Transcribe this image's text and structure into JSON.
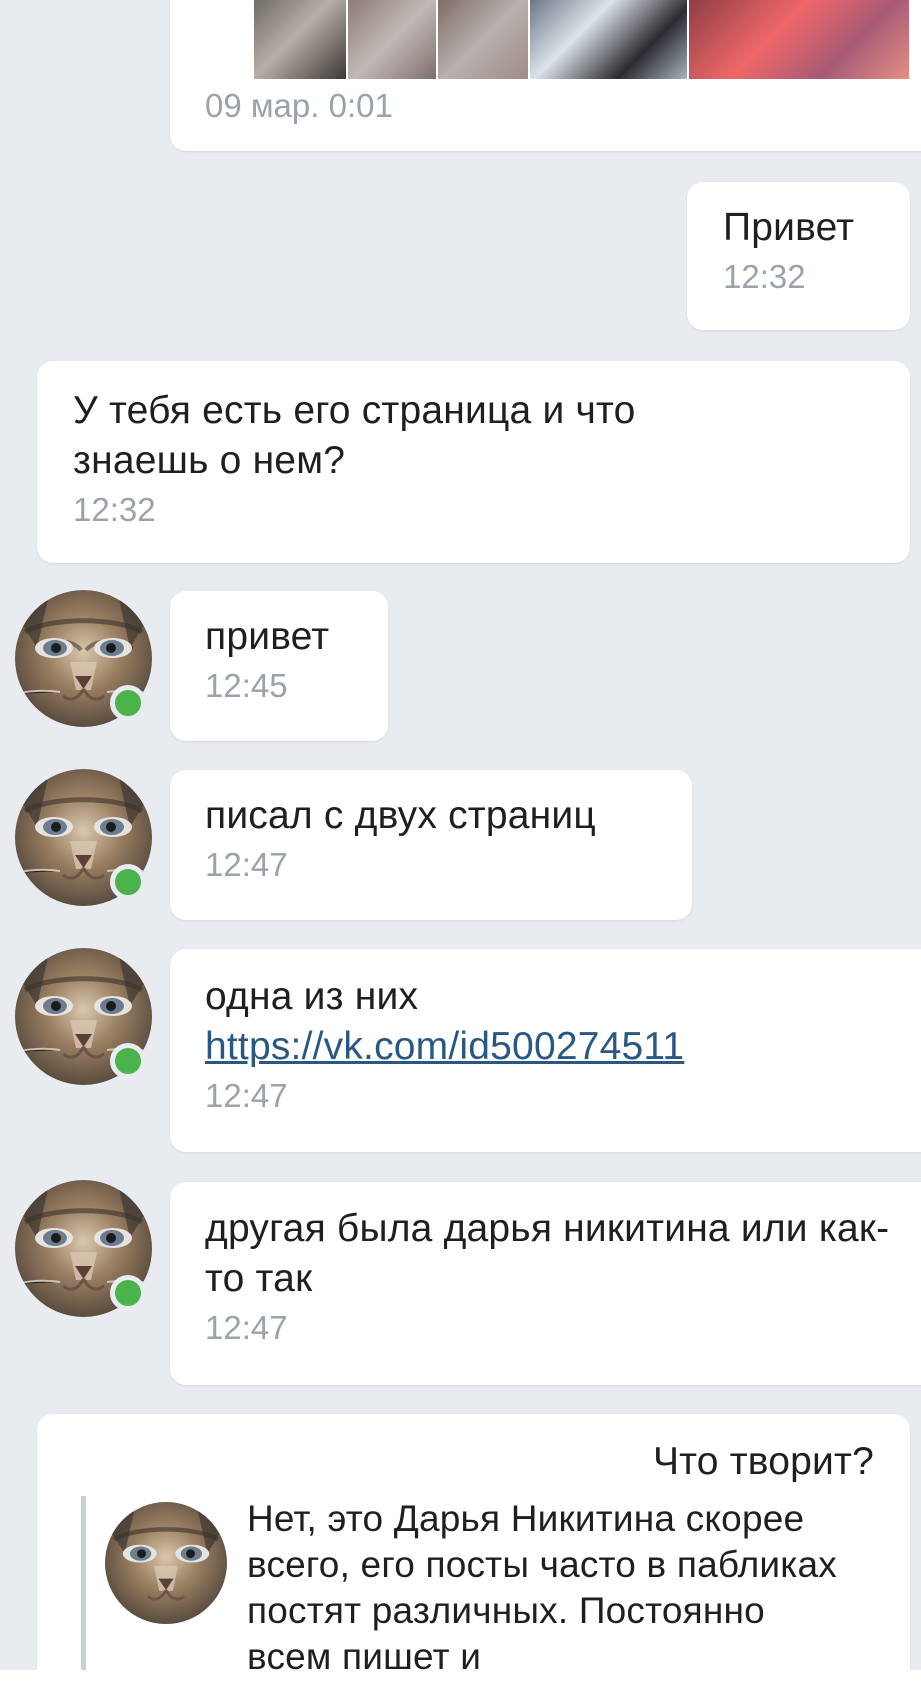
{
  "conversation": {
    "attachment_message": {
      "photos": [
        "photo-1",
        "photo-2",
        "photo-3",
        "photo-4",
        "photo-5"
      ],
      "time": "09 мар. 0:01"
    },
    "messages": [
      {
        "side": "out",
        "text": "Привет",
        "time": "12:32"
      },
      {
        "side": "out",
        "text": "У тебя есть его страница и что знаешь о нем?",
        "time": "12:32"
      },
      {
        "side": "in",
        "text": "привет",
        "time": "12:45"
      },
      {
        "side": "in",
        "text": "писал с двух страниц",
        "time": "12:47"
      },
      {
        "side": "in",
        "text": "одна из них",
        "link": "https://vk.com/id500274511",
        "time": "12:47"
      },
      {
        "side": "in",
        "text": "другая была дарья никитина или как-то так",
        "time": "12:47"
      }
    ],
    "reply_message": {
      "text": "Что творит?",
      "quote": "Нет, это Дарья Никитина скорее всего, его посты часто в пабликах постят различных. Постоянно всем пишет и"
    }
  },
  "colors": {
    "chat_background": "#e8ebf0",
    "bubble": "#ffffff",
    "text": "#1f1f1f",
    "time": "#9aa2ab",
    "link": "#2a5885",
    "online": "#4bb34b",
    "quote_bar": "#c5d0db"
  },
  "icons": {
    "avatar": "cat-avatar",
    "online": "online-indicator"
  }
}
